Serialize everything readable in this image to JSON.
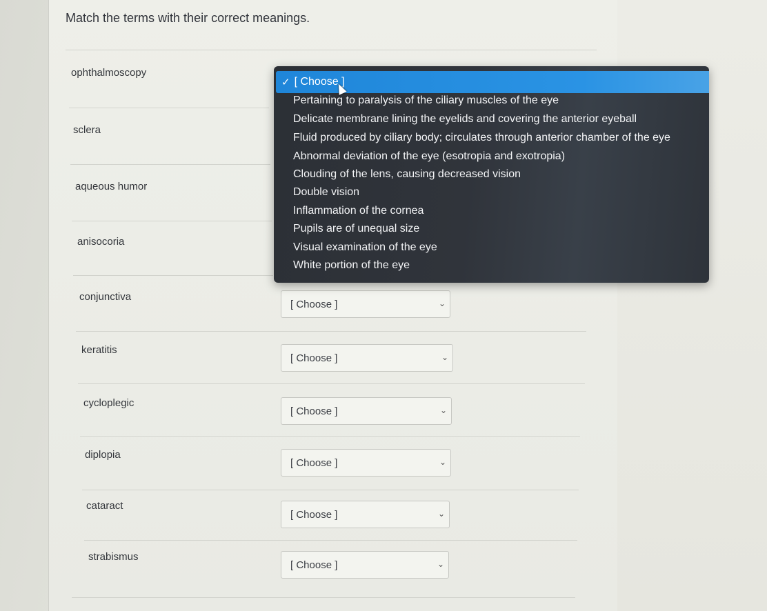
{
  "question": "Match the terms with their correct meanings.",
  "terms": [
    {
      "label": "ophthalmoscopy"
    },
    {
      "label": "sclera"
    },
    {
      "label": "aqueous humor"
    },
    {
      "label": "anisocoria"
    },
    {
      "label": "conjunctiva",
      "selected": "[ Choose ]"
    },
    {
      "label": "keratitis",
      "selected": "[ Choose ]"
    },
    {
      "label": "cycloplegic",
      "selected": "[ Choose ]"
    },
    {
      "label": "diplopia",
      "selected": "[ Choose ]"
    },
    {
      "label": "cataract",
      "selected": "[ Choose ]"
    },
    {
      "label": "strabismus",
      "selected": "[ Choose ]"
    }
  ],
  "dropdown": {
    "selected": "[ Choose ]",
    "options": [
      "Pertaining to paralysis of the ciliary muscles of the eye",
      "Delicate membrane lining the eyelids and covering the anterior eyeball",
      "Fluid produced by ciliary body; circulates through anterior chamber of the eye",
      "Abnormal deviation of the eye (esotropia and exotropia)",
      "Clouding of the lens, causing decreased vision",
      "Double vision",
      "Inflammation of the cornea",
      "Pupils are of unequal size",
      "Visual examination of the eye",
      "White portion of the eye"
    ]
  },
  "icons": {
    "check": "✓",
    "chevron": "⌄"
  },
  "colors": {
    "highlight": "#1f86d9",
    "menu_bg": "#30343b"
  }
}
